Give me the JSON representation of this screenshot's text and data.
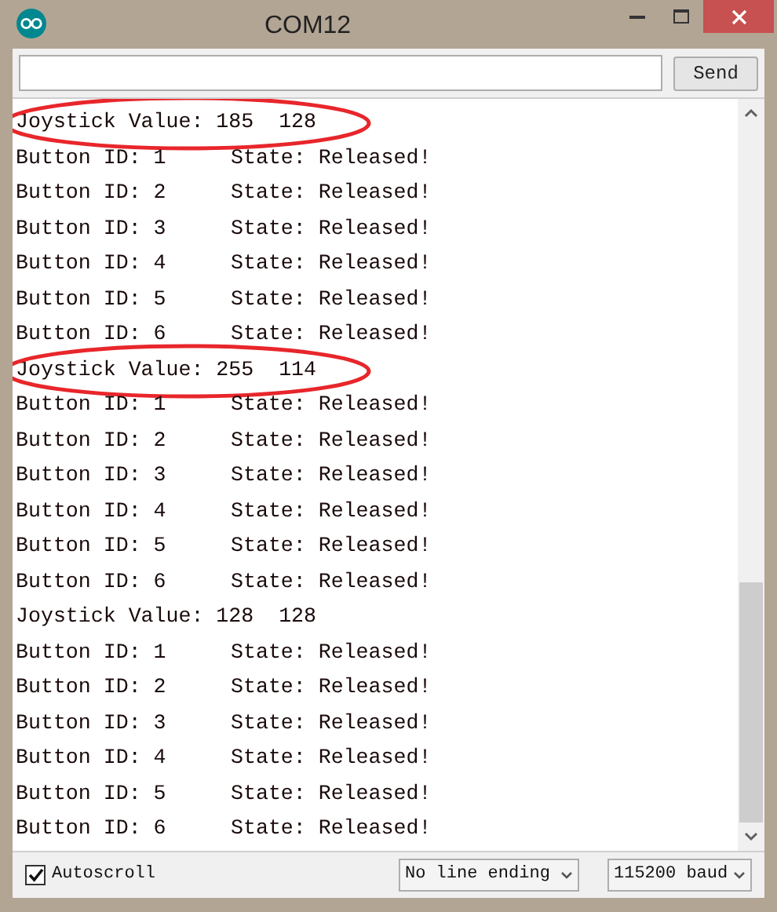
{
  "window": {
    "title": "COM12"
  },
  "send_button": {
    "label": "Send"
  },
  "lines": [
    {
      "kind": "joystick",
      "text": "Joystick Value: 185  128",
      "highlighted": true
    },
    {
      "kind": "button",
      "id": "Button ID: 1",
      "state": "State: Released!"
    },
    {
      "kind": "button",
      "id": "Button ID: 2",
      "state": "State: Released!"
    },
    {
      "kind": "button",
      "id": "Button ID: 3",
      "state": "State: Released!"
    },
    {
      "kind": "button",
      "id": "Button ID: 4",
      "state": "State: Released!"
    },
    {
      "kind": "button",
      "id": "Button ID: 5",
      "state": "State: Released!"
    },
    {
      "kind": "button",
      "id": "Button ID: 6",
      "state": "State: Released!"
    },
    {
      "kind": "joystick",
      "text": "Joystick Value: 255  114",
      "highlighted": true
    },
    {
      "kind": "button",
      "id": "Button ID: 1",
      "state": "State: Released!"
    },
    {
      "kind": "button",
      "id": "Button ID: 2",
      "state": "State: Released!"
    },
    {
      "kind": "button",
      "id": "Button ID: 3",
      "state": "State: Released!"
    },
    {
      "kind": "button",
      "id": "Button ID: 4",
      "state": "State: Released!"
    },
    {
      "kind": "button",
      "id": "Button ID: 5",
      "state": "State: Released!"
    },
    {
      "kind": "button",
      "id": "Button ID: 6",
      "state": "State: Released!"
    },
    {
      "kind": "joystick",
      "text": "Joystick Value: 128  128",
      "highlighted": false
    },
    {
      "kind": "button",
      "id": "Button ID: 1",
      "state": "State: Released!"
    },
    {
      "kind": "button",
      "id": "Button ID: 2",
      "state": "State: Released!"
    },
    {
      "kind": "button",
      "id": "Button ID: 3",
      "state": "State: Released!"
    },
    {
      "kind": "button",
      "id": "Button ID: 4",
      "state": "State: Released!"
    },
    {
      "kind": "button",
      "id": "Button ID: 5",
      "state": "State: Released!"
    },
    {
      "kind": "button",
      "id": "Button ID: 6",
      "state": "State: Released!"
    }
  ],
  "autoscroll": {
    "label": "Autoscroll",
    "checked": true
  },
  "line_ending": {
    "value": "No line ending"
  },
  "baud_rate": {
    "value": "115200 baud"
  }
}
